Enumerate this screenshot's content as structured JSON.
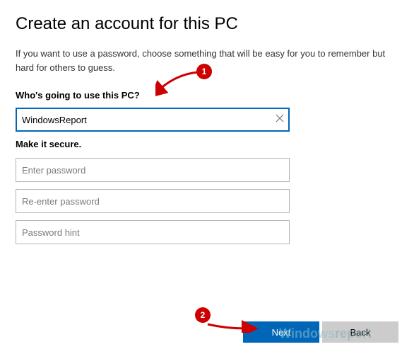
{
  "header": {
    "title": "Create an account for this PC",
    "subtitle": "If you want to use a password, choose something that will be easy for you to remember but hard for others to guess."
  },
  "user_section": {
    "label": "Who's going to use this PC?",
    "username_value": "WindowsReport"
  },
  "password_section": {
    "label": "Make it secure.",
    "password_placeholder": "Enter password",
    "confirm_placeholder": "Re-enter password",
    "hint_placeholder": "Password hint"
  },
  "buttons": {
    "next": "Next",
    "back": "Back"
  },
  "callouts": {
    "one": "1",
    "two": "2"
  },
  "watermark": {
    "part1": "Windows",
    "part2": "report"
  }
}
